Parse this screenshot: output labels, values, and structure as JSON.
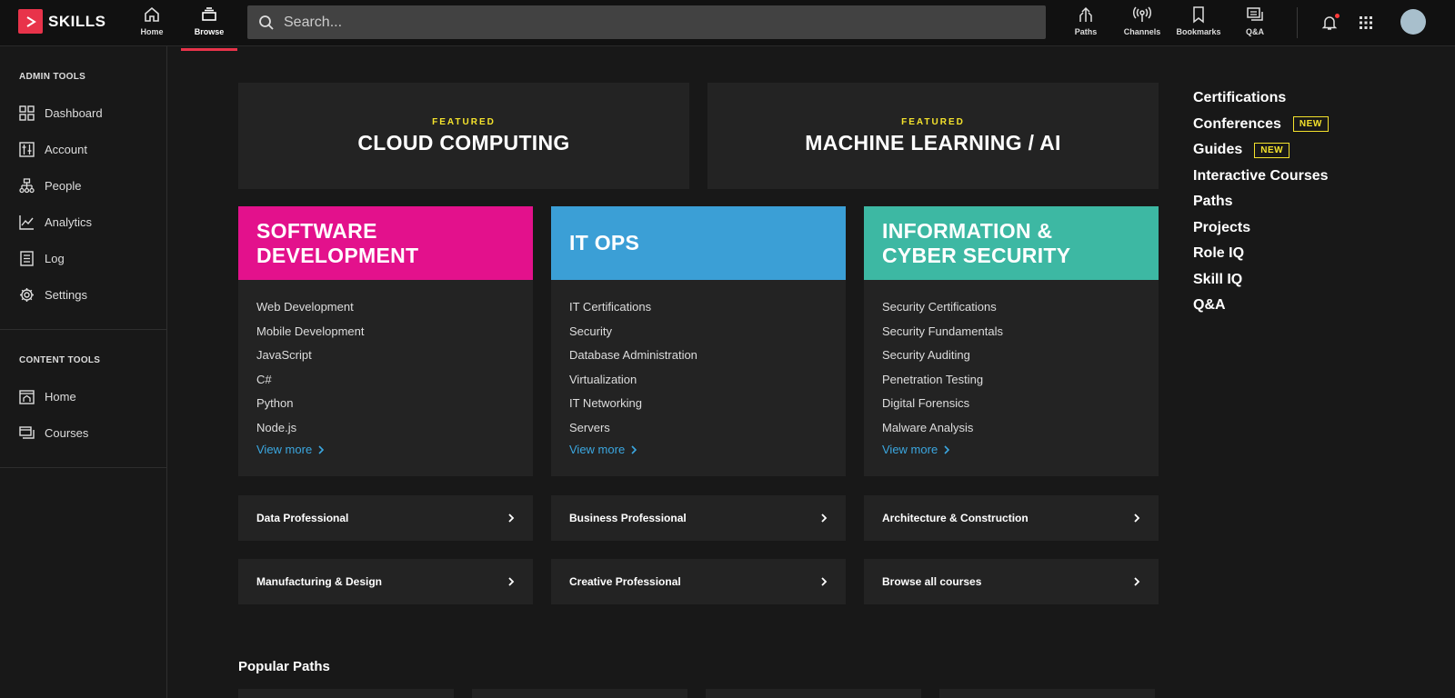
{
  "brand": {
    "name": "SKILLS",
    "accent": "#e8334a"
  },
  "topnav": {
    "home_label": "Home",
    "browse_label": "Browse",
    "search_placeholder": "Search...",
    "paths_label": "Paths",
    "channels_label": "Channels",
    "bookmarks_label": "Bookmarks",
    "qa_label": "Q&A"
  },
  "sidebar": {
    "admin_title": "ADMIN TOOLS",
    "admin_items": [
      {
        "label": "Dashboard",
        "icon": "dashboard-icon"
      },
      {
        "label": "Account",
        "icon": "account-icon"
      },
      {
        "label": "People",
        "icon": "people-icon"
      },
      {
        "label": "Analytics",
        "icon": "analytics-icon"
      },
      {
        "label": "Log",
        "icon": "log-icon"
      },
      {
        "label": "Settings",
        "icon": "gear-icon"
      }
    ],
    "content_title": "CONTENT TOOLS",
    "content_items": [
      {
        "label": "Home",
        "icon": "home-icon"
      },
      {
        "label": "Courses",
        "icon": "courses-icon"
      }
    ]
  },
  "featured": [
    {
      "kicker": "FEATURED",
      "title": "CLOUD COMPUTING"
    },
    {
      "kicker": "FEATURED",
      "title": "MACHINE LEARNING / AI"
    }
  ],
  "categories": [
    {
      "title_line1": "SOFTWARE",
      "title_line2": "DEVELOPMENT",
      "color": "#e3118c",
      "items": [
        "Web Development",
        "Mobile Development",
        "JavaScript",
        "C#",
        "Python",
        "Node.js"
      ],
      "view_more": "View more"
    },
    {
      "title_line1": "IT OPS",
      "title_line2": "",
      "color": "#3b9fd6",
      "items": [
        "IT Certifications",
        "Security",
        "Database Administration",
        "Virtualization",
        "IT Networking",
        "Servers"
      ],
      "view_more": "View more"
    },
    {
      "title_line1": "INFORMATION &",
      "title_line2": "CYBER SECURITY",
      "color": "#3db8a3",
      "items": [
        "Security Certifications",
        "Security Fundamentals",
        "Security Auditing",
        "Penetration Testing",
        "Digital Forensics",
        "Malware Analysis"
      ],
      "view_more": "View more"
    }
  ],
  "row_links": [
    "Data Professional",
    "Business Professional",
    "Architecture & Construction",
    "Manufacturing & Design",
    "Creative Professional",
    "Browse all courses"
  ],
  "popular_title": "Popular Paths",
  "right_links": [
    {
      "label": "Certifications",
      "badge": ""
    },
    {
      "label": "Conferences",
      "badge": "NEW"
    },
    {
      "label": "Guides",
      "badge": "NEW"
    },
    {
      "label": "Interactive Courses",
      "badge": ""
    },
    {
      "label": "Paths",
      "badge": ""
    },
    {
      "label": "Projects",
      "badge": ""
    },
    {
      "label": "Role IQ",
      "badge": ""
    },
    {
      "label": "Skill IQ",
      "badge": ""
    },
    {
      "label": "Q&A",
      "badge": ""
    }
  ]
}
